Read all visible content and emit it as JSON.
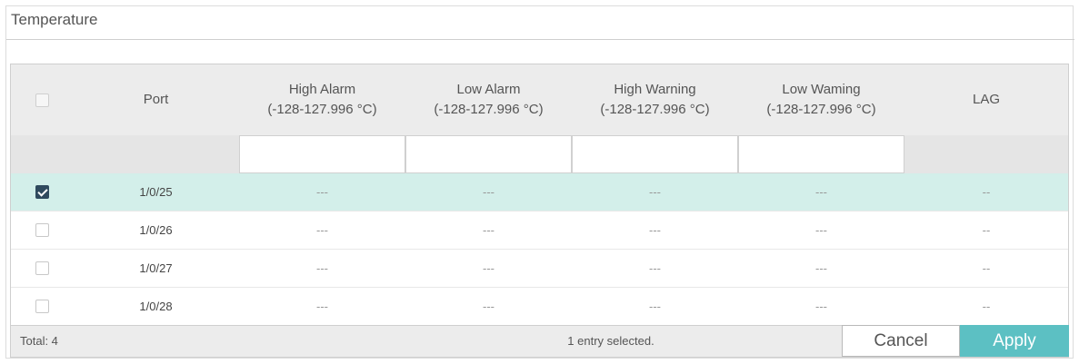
{
  "panel": {
    "title": "Temperature"
  },
  "table": {
    "columns": {
      "port": "Port",
      "high_alarm": {
        "label": "High Alarm",
        "range": "(-128-127.996 °C)"
      },
      "low_alarm": {
        "label": "Low Alarm",
        "range": "(-128-127.996 °C)"
      },
      "high_warning": {
        "label": "High Warning",
        "range": "(-128-127.996 °C)"
      },
      "low_warning": {
        "label": "Low Waming",
        "range": "(-128-127.996 °C)"
      },
      "lag": "LAG"
    },
    "filters": {
      "high_alarm": "",
      "low_alarm": "",
      "high_warning": "",
      "low_warning": ""
    },
    "rows": [
      {
        "selected": true,
        "port": "1/0/25",
        "high_alarm": "---",
        "low_alarm": "---",
        "high_warning": "---",
        "low_warning": "---",
        "lag": "--"
      },
      {
        "selected": false,
        "port": "1/0/26",
        "high_alarm": "---",
        "low_alarm": "---",
        "high_warning": "---",
        "low_warning": "---",
        "lag": "--"
      },
      {
        "selected": false,
        "port": "1/0/27",
        "high_alarm": "---",
        "low_alarm": "---",
        "high_warning": "---",
        "low_warning": "---",
        "lag": "--"
      },
      {
        "selected": false,
        "port": "1/0/28",
        "high_alarm": "---",
        "low_alarm": "---",
        "high_warning": "---",
        "low_warning": "---",
        "lag": "--"
      }
    ]
  },
  "footer": {
    "total": "Total: 4",
    "status": "1 entry selected.",
    "cancel_label": "Cancel",
    "apply_label": "Apply"
  },
  "colors": {
    "selected_row": "#d3efea",
    "apply": "#5cc0c3",
    "checked": "#2f4a5e"
  }
}
